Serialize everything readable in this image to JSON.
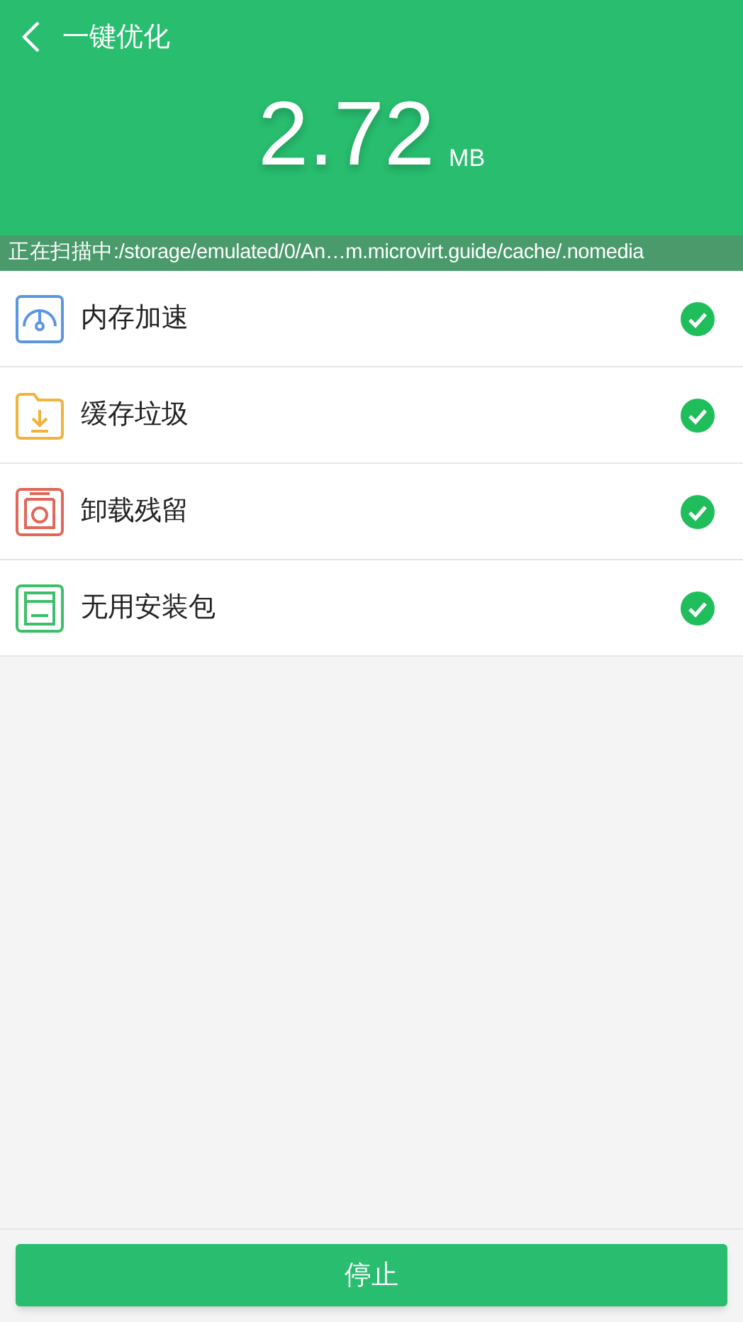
{
  "header": {
    "title": "一键优化",
    "size": "2.72",
    "unit": "MB"
  },
  "scan_status": "正在扫描中:/storage/emulated/0/An…m.microvirt.guide/cache/.nomedia",
  "items": [
    {
      "kind": "memory",
      "label": "内存加速",
      "checked": true
    },
    {
      "kind": "cache",
      "label": "缓存垃圾",
      "checked": true
    },
    {
      "kind": "residue",
      "label": "卸载残留",
      "checked": true
    },
    {
      "kind": "package",
      "label": "无用安装包",
      "checked": true
    }
  ],
  "stop_button": "停止"
}
